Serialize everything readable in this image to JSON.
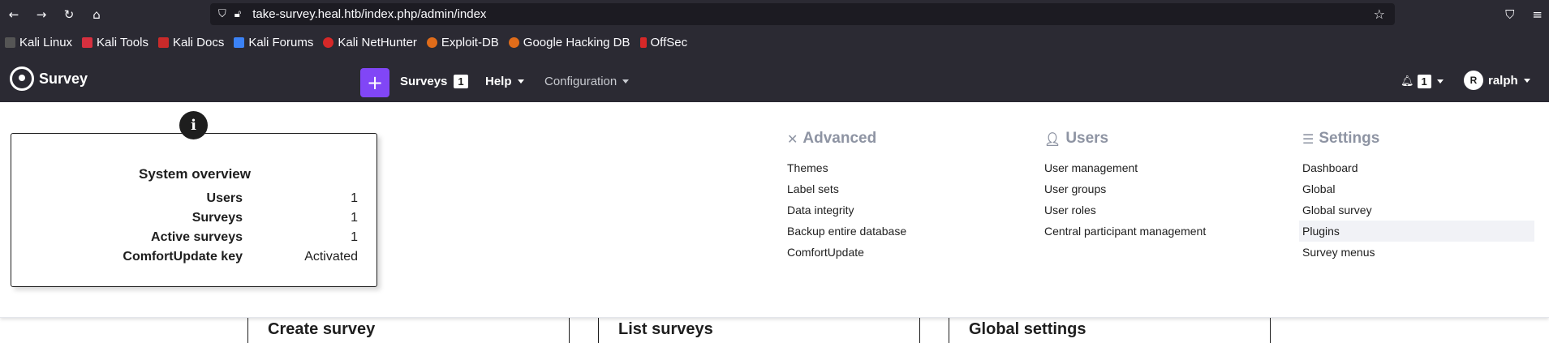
{
  "browser": {
    "url": "take-survey.heal.htb/index.php/admin/index"
  },
  "bookmarks": [
    {
      "label": "Kali Linux",
      "color": "#1e1e1e"
    },
    {
      "label": "Kali Tools",
      "color": "#d6303f"
    },
    {
      "label": "Kali Docs",
      "color": "#c92a2a"
    },
    {
      "label": "Kali Forums",
      "color": "#3b82f6"
    },
    {
      "label": "Kali NetHunter",
      "color": "#d62828"
    },
    {
      "label": "Exploit-DB",
      "color": "#e06c1a"
    },
    {
      "label": "Google Hacking DB",
      "color": "#e06c1a"
    },
    {
      "label": "OffSec",
      "color": "#d62828"
    }
  ],
  "app": {
    "brand": "Survey",
    "nav": {
      "add_icon": "+",
      "surveys_label": "Surveys",
      "surveys_count": "1",
      "help_label": "Help",
      "configuration_label": "Configuration",
      "notifications_count": "1",
      "user_initial": "R",
      "user_name": "ralph"
    }
  },
  "overview": {
    "title": "System overview",
    "info_icon": "i",
    "rows": [
      {
        "label": "Users",
        "value": "1"
      },
      {
        "label": "Surveys",
        "value": "1"
      },
      {
        "label": "Active surveys",
        "value": "1"
      },
      {
        "label": "ComfortUpdate key",
        "value": "Activated"
      }
    ]
  },
  "menu": {
    "advanced": {
      "title": "Advanced",
      "items": [
        "Themes",
        "Label sets",
        "Data integrity",
        "Backup entire database",
        "ComfortUpdate"
      ]
    },
    "users": {
      "title": "Users",
      "items": [
        "User management",
        "User groups",
        "User roles",
        "Central participant management"
      ]
    },
    "settings": {
      "title": "Settings",
      "items": [
        "Dashboard",
        "Global",
        "Global survey",
        "Plugins",
        "Survey menus"
      ]
    }
  },
  "cards": [
    {
      "title": "Create survey"
    },
    {
      "title": "List surveys"
    },
    {
      "title": "Global settings"
    }
  ],
  "colors": {
    "accent": "#8146f6",
    "navbar": "#2b2a33"
  }
}
